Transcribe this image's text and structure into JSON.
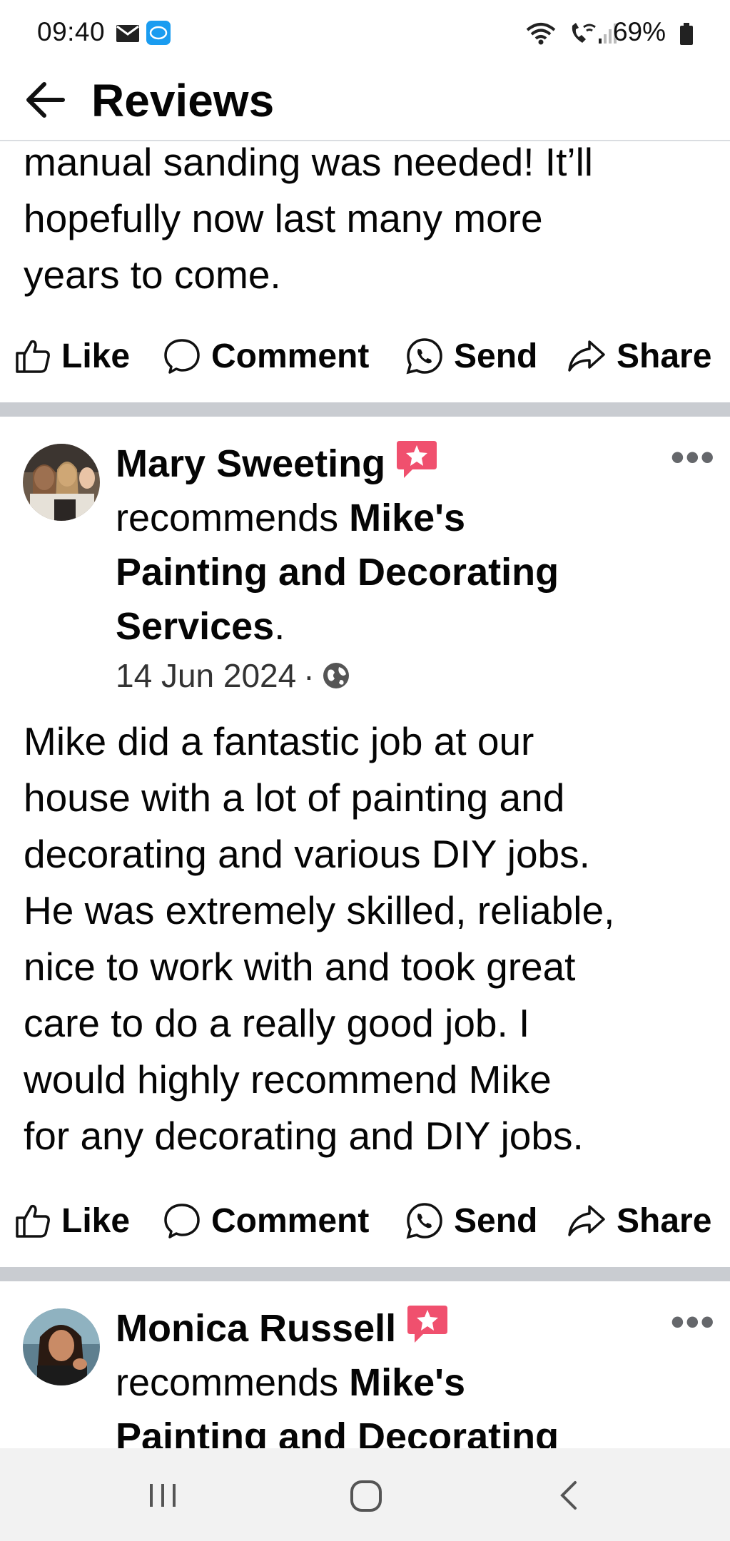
{
  "status_bar": {
    "time": "09:40",
    "battery": "69%",
    "icons": [
      "mail-icon",
      "box-app-icon",
      "wifi-icon",
      "wifi-calling-icon",
      "signal-icon",
      "battery-icon"
    ]
  },
  "header": {
    "title": "Reviews",
    "back_icon": "arrow-left-icon"
  },
  "prev_post": {
    "text_tail": [
      "manual sanding was needed! It’ll",
      "hopefully now last many more",
      "years to come."
    ]
  },
  "actions": {
    "like": "Like",
    "comment": "Comment",
    "send": "Send",
    "share": "Share"
  },
  "reviews": [
    {
      "author": "Mary Sweeting",
      "recommends": "recommends",
      "business_line1": "Mike's",
      "business_line2": "Painting and Decorating",
      "business_line3": "Services",
      "period": ".",
      "date": "14 Jun 2024",
      "dot": "·",
      "audience_icon": "globe-icon",
      "text": [
        "Mike did a fantastic job at our",
        "house with a lot of painting and",
        "decorating and various DIY jobs.",
        "He was extremely skilled, reliable,",
        "nice to work with and took great",
        "care to do a really good job. I",
        "would highly recommend Mike",
        "for any decorating and DIY jobs."
      ]
    },
    {
      "author": "Monica Russell",
      "recommends": "recommends",
      "business_line1": "Mike's",
      "business_line2": "Painting and Decorating"
    }
  ],
  "more_label": "•••",
  "colors": {
    "recommend_badge": "#f0506e",
    "separator": "#c9ccd1",
    "text": "#050505"
  }
}
